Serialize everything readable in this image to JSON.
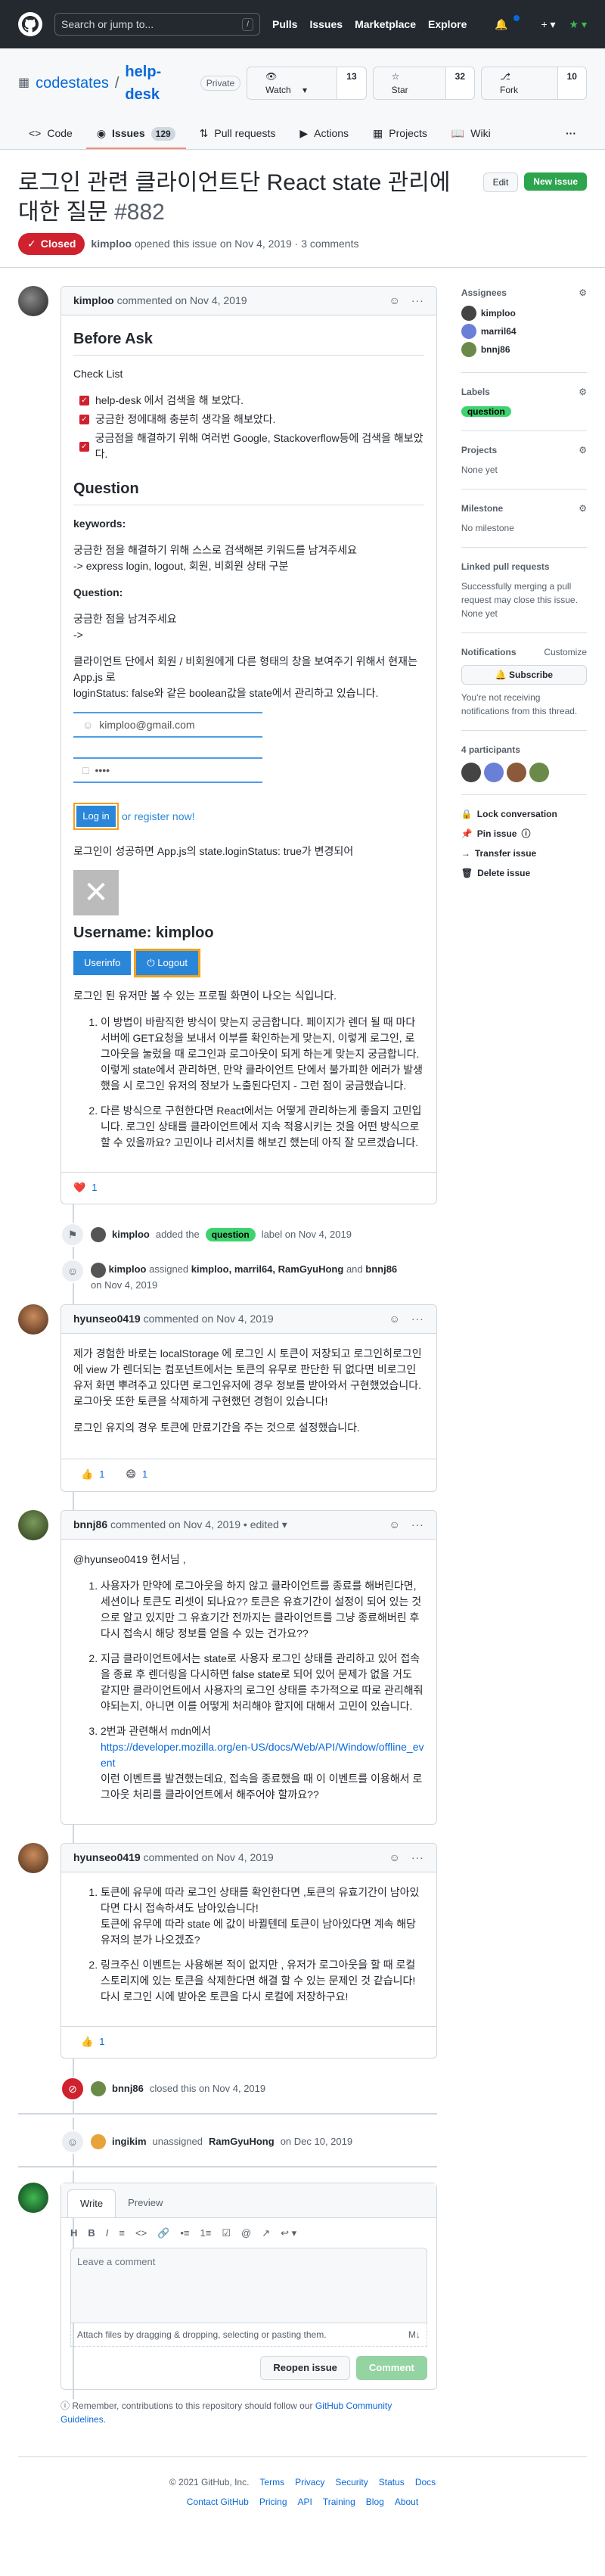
{
  "nav": {
    "search_placeholder": "Search or jump to...",
    "search_key": "/",
    "links": [
      "Pulls",
      "Issues",
      "Marketplace",
      "Explore"
    ]
  },
  "repo": {
    "owner": "codestates",
    "name": "help-desk",
    "visibility": "Private",
    "watch_label": "Watch",
    "watch_count": "13",
    "star_label": "Star",
    "star_count": "32",
    "fork_label": "Fork",
    "fork_count": "10",
    "tabs": {
      "code": "Code",
      "issues": "Issues",
      "issues_count": "129",
      "pulls": "Pull requests",
      "actions": "Actions",
      "projects": "Projects",
      "wiki": "Wiki",
      "more": "···"
    }
  },
  "issue": {
    "title": "로그인 관련 클라이언트단 React state 관리에 대한 질문",
    "number": "#882",
    "edit_label": "Edit",
    "new_issue_label": "New issue",
    "state": "Closed",
    "author": "kimploo",
    "meta_text": "opened this issue on Nov 4, 2019 · 3 comments"
  },
  "first_comment": {
    "author": "kimploo",
    "when": "commented on Nov 4, 2019",
    "before_ask": "Before Ask",
    "checklist_title": "Check List",
    "checklist": [
      "help-desk 에서 검색을 해 보았다.",
      "궁금한 정에대해 충분히 생각을 해보았다.",
      "궁금점을 해결하기 위해 여러번 Google, Stackoverflow등에 검색을 해보았다."
    ],
    "question_heading": "Question",
    "keywords_label": "keywords:",
    "keywords_line1": "궁금한 점을 해결하기 위해 스스로 검색해본 키워드를 남겨주세요",
    "keywords_line2": "-> express login, logout, 회원, 비회원 상태 구분",
    "question_label": "Question:",
    "question_line1": "궁금한 점을 남겨주세요",
    "question_line2": "->",
    "question_para1a": "클라이언트 단에서 회원 / 비회원에게 다른 형태의 창을 보여주기 위해서 현재는 App.js 로",
    "question_para1b": "loginStatus: false와 같은 boolean값을 state에서 관리하고 있습니다.",
    "mock_email": "kimploo@gmail.com",
    "mock_password": "••••",
    "mock_login_btn": "Log in",
    "mock_register": "or register now!",
    "after_login_text": "로그인이 성공하면 App.js의 state.loginStatus: true가 변경되어",
    "mock_username": "Username: kimploo",
    "mock_userinfo": "Userinfo",
    "mock_logout": "Logout",
    "after_image_text": "로그인 된 유저만 볼 수 있는 프로필 화면이 나오는 식입니다.",
    "list": [
      "이 방법이 바람직한 방식이 맞는지 궁금합니다. 페이지가 렌더 될 때 마다 서버에 GET요청을 보내서 이부를 확인하는게 맞는지, 이렇게 로그인, 로그아웃을 눌렀을 때 로그인과 로그아웃이 되게 하는게 맞는지 궁금합니다. 이렇게 state에서 관리하면, 만약 클라이언트 단에서 불가피한 에러가 발생했을 시 로그인 유저의 정보가 노출된다던지 - 그런 점이 궁금했습니다.",
      "다른 방식으로 구현한다면 React에서는 어떻게 관리하는게 좋을지 고민입니다. 로그인 상태를 클라이언트에서 지속 적용시키는 것을 어떤 방식으로 할 수 있을까요? 고민이나 리서치를 해보긴 했는데 아직 잘 모르겠습니다."
    ],
    "reaction_emoji": "❤️",
    "reaction_count": "1"
  },
  "events": {
    "label_actor": "kimploo",
    "label_added": "added the",
    "label_name": "question",
    "label_suffix": "label on Nov 4, 2019",
    "assign_actor": "kimploo",
    "assign_text": "assigned",
    "assignees_text": "kimploo, marril64, RamGyuHong",
    "assign_and": "and",
    "assign_last": "bnnj86",
    "assign_when": "on Nov 4, 2019",
    "closed_actor": "bnnj86",
    "closed_text": "closed this on Nov 4, 2019",
    "unassign_actor": "ingikim",
    "unassign_text": "unassigned",
    "unassign_target": "RamGyuHong",
    "unassign_when": "on Dec 10, 2019"
  },
  "comment2": {
    "author": "hyunseo0419",
    "when": "commented on Nov 4, 2019",
    "p1": "제가 경험한 바로는 localStorage 에 로그인 시 토큰이 저장되고 로그인히로그인에 view 가 렌더되는 컴포넌트에서는 토큰의 유무로 판단한 뒤 없다면 비로그인 유저 화면 뿌려주고 있다면 로그인유저에 경우 정보를 받아와서 구현했었습니다. 로그아웃 또한 토큰을 삭제하게 구현했던 경험이 있습니다!",
    "p2": "로그인 유지의 경우 토큰에 만료기간을 주는 것으로 설정했습니다.",
    "r1_emoji": "👍",
    "r1_count": "1",
    "r2_emoji": "😄",
    "r2_count": "1"
  },
  "comment3": {
    "author": "bnnj86",
    "when": "commented on Nov 4, 2019 • edited",
    "mention": "@hyunseo0419 현서님 ,",
    "items": [
      "사용자가 만약에 로그아웃을 하지 않고 클라이언트를 종료를 해버린다면, 세션이나 토큰도 리셋이 되나요?? 토큰은 유효기간이 설정이 되어 있는 것으로 알고 있지만 그 유효기간 전까지는 클라이언트를 그냥 종료해버린 후 다시 접속시 해당 정보를 얻을 수 있는 건가요??",
      "지금 클라이언트에서는 state로 사용자 로그인 상태를 관리하고 있어 접속을 종료 후 렌더링을 다시하면 false state로 되어 있어 문제가 없을 거도 같지만 클라이언트에서 사용자의 로그인 상태를 추가적으로 따로 관리해줘야되는지, 아니면 이를 어떻게 처리해야 할지에 대해서 고민이 있습니다.",
      "2번과 관련해서 mdn에서"
    ],
    "link": "https://developer.mozilla.org/en-US/docs/Web/API/Window/offline_event",
    "link_after": "이런 이벤트를 발견했는데요, 접속을 종료했을 때 이 이벤트를 이용해서 로그아웃 처리를 클라이언트에서 해주어야 할까요??"
  },
  "comment4": {
    "author": "hyunseo0419",
    "when": "commented on Nov 4, 2019",
    "item1a": "토큰에 유무에 따라 로그인 상태를 확인한다면 ,토큰의 유효기간이 남아있다면 다시 접속하셔도 남아있습니다!",
    "item1b": "토큰에 유무에 따라 state 에 값이 바뀔텐데 토큰이 남아있다면 계속 해당 유저의 분가 나오겠죠?",
    "item2": "링크주신 이벤트는 사용해본 적이 없지만 , 유저가 로그아웃을 할 때 로컬스토리지에 있는 토큰을 삭제한다면 해결 할 수 있는 문제인 것 같습니다! 다시 로그인 시에 받아온 토큰을 다시 로컬에 저장하구요!",
    "r1_emoji": "👍",
    "r1_count": "1"
  },
  "composer": {
    "write_tab": "Write",
    "preview_tab": "Preview",
    "placeholder": "Leave a comment",
    "attach_text": "Attach files by dragging & dropping, selecting or pasting them.",
    "reopen_label": "Reopen issue",
    "comment_label": "Comment",
    "notice_pre": "Remember, contributions to this repository should follow our",
    "notice_link": "GitHub Community Guidelines",
    "notice_post": "."
  },
  "sidebar": {
    "assignees_title": "Assignees",
    "assignees": [
      "kimploo",
      "marril64",
      "bnnj86"
    ],
    "labels_title": "Labels",
    "label": "question",
    "projects_title": "Projects",
    "projects_value": "None yet",
    "milestone_title": "Milestone",
    "milestone_value": "No milestone",
    "linked_title": "Linked pull requests",
    "linked_value": "Successfully merging a pull request may close this issue.",
    "linked_none": "None yet",
    "notifications_title": "Notifications",
    "customize": "Customize",
    "subscribe": "Subscribe",
    "notif_text": "You're not receiving notifications from this thread.",
    "participants_title": "4 participants",
    "lock": "Lock conversation",
    "pin": "Pin issue",
    "transfer": "Transfer issue",
    "delete": "Delete issue"
  },
  "footer": {
    "copyright": "© 2021 GitHub, Inc.",
    "row1": [
      "Terms",
      "Privacy",
      "Security",
      "Status",
      "Docs"
    ],
    "row2": [
      "Contact GitHub",
      "Pricing",
      "API",
      "Training",
      "Blog",
      "About"
    ]
  },
  "colors": {
    "closed": "#cf222e",
    "label_question": "#3fd36f",
    "primary": "#2da44e"
  }
}
